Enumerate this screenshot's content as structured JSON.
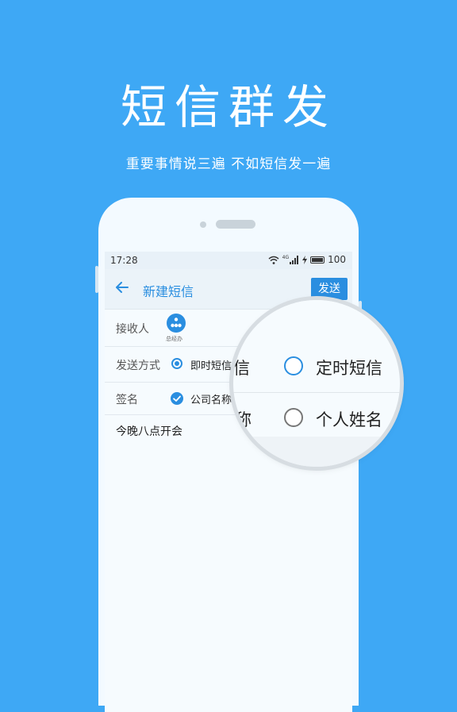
{
  "promo": {
    "headline": "短信群发",
    "tagline": "重要事情说三遍  不如短信发一遍"
  },
  "statusbar": {
    "time": "17:28",
    "network": "4G",
    "battery": "100"
  },
  "toolbar": {
    "title": "新建短信",
    "send_label": "发送"
  },
  "form": {
    "recipient_label": "接收人",
    "recipient_name": "总经办",
    "send_mode_label": "发送方式",
    "send_mode_option": "即时短信",
    "signature_label": "签名",
    "signature_option": "公司名称",
    "message_text": "今晚八点开会"
  },
  "magnifier": {
    "left_fragment_1": "信",
    "option_scheduled": "定时短信",
    "left_fragment_2": "称",
    "option_personal": "个人姓名"
  },
  "colors": {
    "background": "#3ea8f5",
    "accent": "#2a8ee0",
    "radio_scheduled": "#2a8ee0",
    "radio_personal": "#777777"
  }
}
